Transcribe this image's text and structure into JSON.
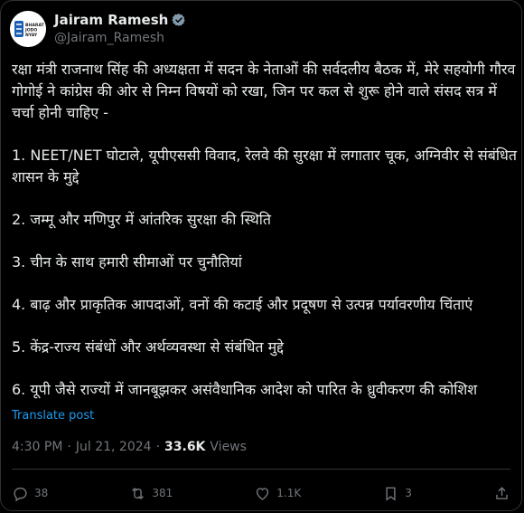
{
  "author": {
    "display_name": "Jairam Ramesh",
    "handle": "@Jairam_Ramesh",
    "avatar_text_lines": [
      "BHARAT",
      "JODO",
      "NYAY"
    ],
    "avatar_accent_color": "#1a5fb4",
    "verified_color": "#829aab"
  },
  "tweet": {
    "paragraphs": [
      "रक्षा मंत्री राजनाथ सिंह की अध्यक्षता में सदन के नेताओं की सर्वदलीय बैठक में, मेरे सहयोगी गौरव गोगोई ने कांग्रेस की ओर से निम्न विषयों को रखा, जिन पर कल से शुरू होने वाले संसद सत्र में चर्चा होनी चाहिए -",
      "1. NEET/NET घोटाले, यूपीएससी विवाद, रेलवे की सुरक्षा में लगातार चूक, अग्निवीर से संबंधित शासन के मुद्दे",
      "2. जम्मू और मणिपुर में आंतरिक सुरक्षा की स्थिति",
      "3. चीन के साथ हमारी सीमाओं पर चुनौतियां",
      "4. बाढ़ और प्राकृतिक आपदाओं, वनों की कटाई और प्रदूषण से उत्पन्न पर्यावरणीय चिंताएं",
      "5. केंद्र-राज्य संबंधों और अर्थव्यवस्था से संबंधित मुद्दे",
      "6. यूपी जैसे राज्यों में जानबूझकर असंवैधानिक आदेश को पारित के ध्रुवीकरण की कोशिश"
    ],
    "translate_label": "Translate post",
    "time": "4:30 PM",
    "separator": "·",
    "date": "Jul 21, 2024",
    "views_count": "33.6K",
    "views_label": "Views"
  },
  "actions": {
    "replies": "38",
    "reposts": "381",
    "likes": "1.1K",
    "bookmarks": "3"
  },
  "colors": {
    "background": "#000000",
    "text": "#e7e9ea",
    "muted": "#71767b",
    "link": "#1d9bf0",
    "border": "#2f3336"
  }
}
